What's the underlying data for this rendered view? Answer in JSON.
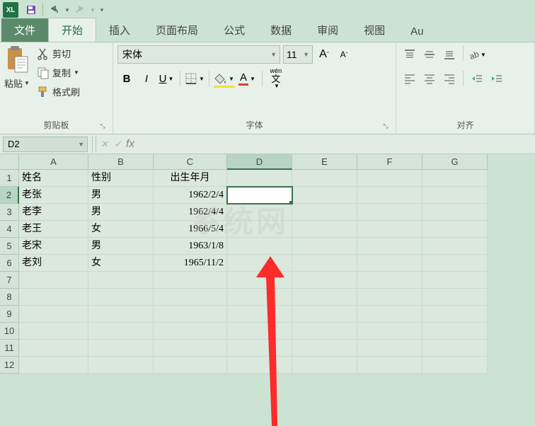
{
  "qat": {
    "app": "XL"
  },
  "tabs": {
    "file": "文件",
    "items": [
      "开始",
      "插入",
      "页面布局",
      "公式",
      "数据",
      "审阅",
      "视图",
      "Au"
    ],
    "active": 0
  },
  "clipboard": {
    "paste": "粘贴",
    "cut": "剪切",
    "copy": "复制",
    "format": "格式刷",
    "group": "剪贴板"
  },
  "font": {
    "name": "宋体",
    "size": "11",
    "bold": "B",
    "italic": "I",
    "underline": "U",
    "ruby": "wén",
    "color_char": "A",
    "group": "字体"
  },
  "align": {
    "group": "对齐"
  },
  "namebox": "D2",
  "sheet": {
    "cols": [
      "A",
      "B",
      "C",
      "D",
      "E",
      "F",
      "G"
    ],
    "headers": [
      "姓名",
      "性别",
      "出生年月"
    ],
    "rows": [
      {
        "a": "老张",
        "b": "男",
        "c": "1962/2/4"
      },
      {
        "a": "老李",
        "b": "男",
        "c": "1962/4/4"
      },
      {
        "a": "老王",
        "b": "女",
        "c": "1966/5/4"
      },
      {
        "a": "老宋",
        "b": "男",
        "c": "1963/1/8"
      },
      {
        "a": "老刘",
        "b": "女",
        "c": "1965/11/2"
      }
    ]
  },
  "watermark": "系统网"
}
